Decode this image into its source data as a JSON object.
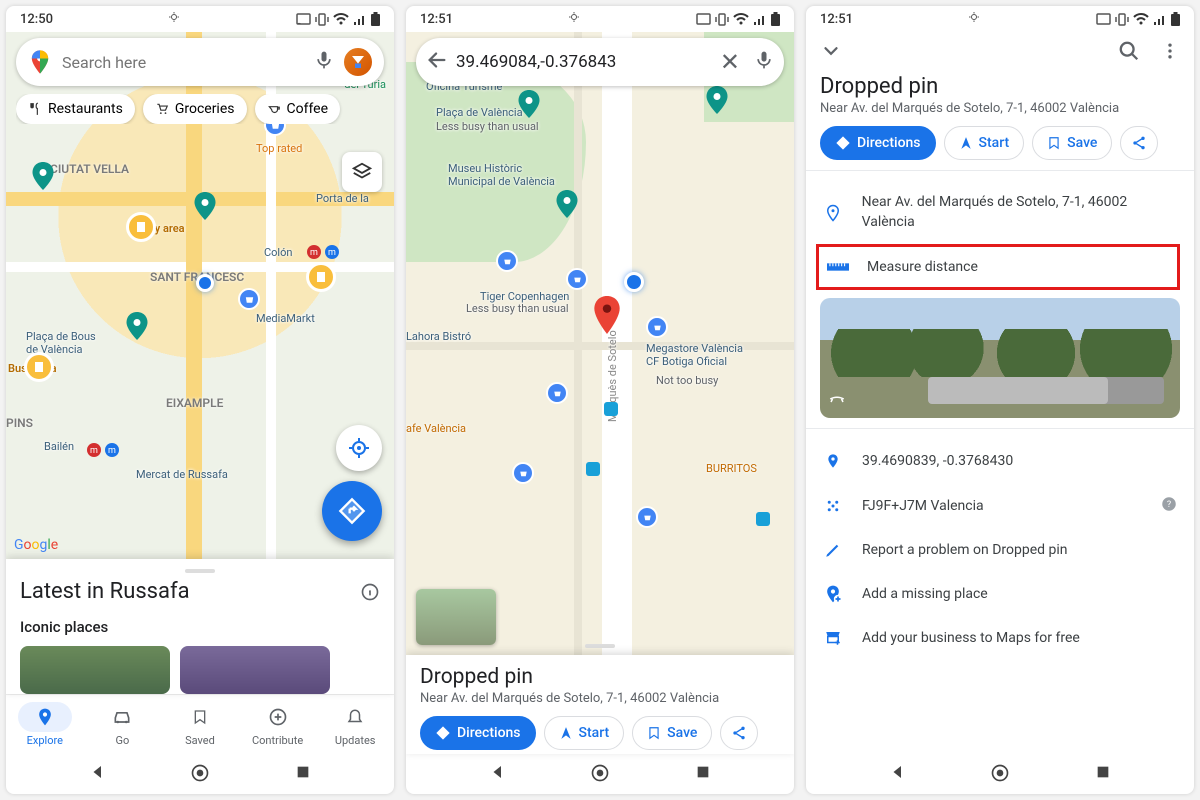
{
  "screen1": {
    "status_time": "12:50",
    "search_placeholder": "Search here",
    "chips": {
      "restaurants": "Restaurants",
      "groceries": "Groceries",
      "coffee": "Coffee"
    },
    "areas": {
      "ciutat_vella": "CIUTAT VELLA",
      "sant_francesc": "SANT FRANCESC",
      "eixample": "EIXAMPLE",
      "pins": "PINS"
    },
    "busy": "Busy area",
    "pois": {
      "placa_bous": "Plaça de Bous\nde València",
      "colon": "Colón",
      "mediamarkt": "MediaMarkt",
      "top_rated": "Top rated",
      "mercat_russafa": "Mercat de Russafa",
      "turia": "del Túria",
      "porta": "Porta de la",
      "bailen": "Bailén"
    },
    "attribution": "Google",
    "latest_title": "Latest in Russafa",
    "iconic_sub": "Iconic places",
    "nav": {
      "explore": "Explore",
      "go": "Go",
      "saved": "Saved",
      "contribute": "Contribute",
      "updates": "Updates"
    }
  },
  "screen2": {
    "status_time": "12:51",
    "search_value": "39.469084,-0.376843",
    "pois": {
      "oficina": "Oficina Turisme",
      "placa": "Plaça de València",
      "less_busy": "Less busy than usual",
      "museu": "Museu Històric\nMunicipal de València",
      "tiger": "Tiger Copenhagen",
      "tiger_sub": "Less busy than usual",
      "lahora": "Lahora Bistró",
      "megastore": "Megastore València\nCF Botiga Oficial",
      "megastore_sub": "Not too busy",
      "cafe": "afe València",
      "burritos": "BURRITOS",
      "street": "Marquès de Sotelo"
    },
    "sheet_title": "Dropped pin",
    "sheet_sub": "Near Av. del Marqués de Sotelo, 7-1, 46002 València",
    "actions": {
      "directions": "Directions",
      "start": "Start",
      "save": "Save"
    }
  },
  "screen3": {
    "status_time": "12:51",
    "title": "Dropped pin",
    "subtitle": "Near Av. del Marqués de Sotelo, 7-1, 46002 València",
    "actions": {
      "directions": "Directions",
      "start": "Start",
      "save": "Save"
    },
    "address_full": "Near Av. del Marqués de Sotelo, 7-1, 46002 València",
    "measure_distance": "Measure distance",
    "coords": "39.4690839, -0.3768430",
    "plus_code": "FJ9F+J7M Valencia",
    "report": "Report a problem on Dropped pin",
    "add_missing": "Add a missing place",
    "add_business": "Add your business to Maps for free"
  }
}
